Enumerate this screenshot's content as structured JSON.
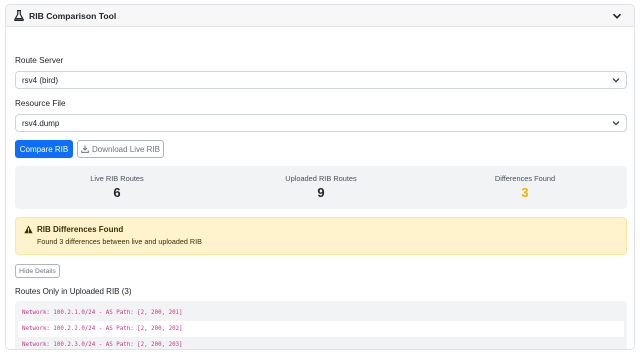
{
  "header": {
    "title": "RIB Comparison Tool",
    "flask_icon": "flask-icon",
    "collapse_icon": "chevron-down-icon"
  },
  "form": {
    "route_server": {
      "label": "Route Server",
      "value": "rsv4 (bird)"
    },
    "resource_file": {
      "label": "Resource File",
      "value": "rsv4.dump"
    }
  },
  "actions": {
    "compare_label": "Compare RIB",
    "download_label": "Download Live RIB",
    "download_icon": "download-icon"
  },
  "stats": [
    {
      "label": "Live RIB Routes",
      "value": "6"
    },
    {
      "label": "Uploaded RIB Routes",
      "value": "9"
    },
    {
      "label": "Differences Found",
      "value": "3"
    }
  ],
  "alert": {
    "title": "RIB Differences Found",
    "message": "Found 3 differences between live and uploaded RIB",
    "icon": "warning-icon"
  },
  "details": {
    "toggle_label": "Hide Details",
    "section_title": "Routes Only in Uploaded RIB (3)",
    "routes": [
      "Network: 100.2.1.0/24 - AS Path: [2, 200, 201]",
      "Network: 100.2.2.0/24 - AS Path: [2, 200, 202]",
      "Network: 100.2.3.0/24 - AS Path: [2, 200, 203]"
    ]
  },
  "colors": {
    "primary": "#0d6efd",
    "warning_value": "#f0b400",
    "alert_bg": "#fff3cd",
    "route_text": "#d63384"
  }
}
